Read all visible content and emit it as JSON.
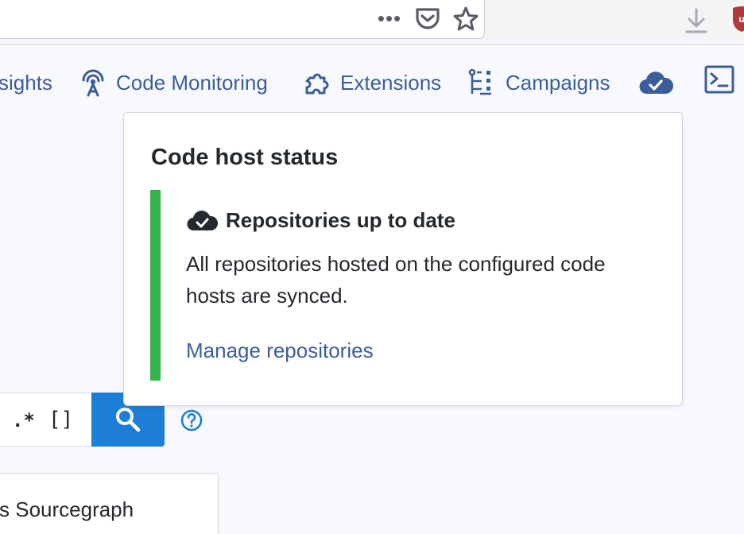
{
  "browser": {
    "more_glyph": "•••",
    "icons": [
      "more-icon",
      "pocket-icon",
      "bookmark-star-icon",
      "download-icon",
      "ublock-icon"
    ]
  },
  "nav": {
    "items": [
      {
        "label": "sights",
        "icon": "insights-icon"
      },
      {
        "label": "Code Monitoring",
        "icon": "antenna-icon"
      },
      {
        "label": "Extensions",
        "icon": "puzzle-icon"
      },
      {
        "label": "Campaigns",
        "icon": "campaigns-icon"
      }
    ],
    "status_icon": "cloud-check-icon",
    "terminal_icon": "terminal-icon"
  },
  "search": {
    "regex_toggle": ".*",
    "structural_toggle": "[]"
  },
  "card": {
    "text": "s Sourcegraph"
  },
  "popover": {
    "title": "Code host status",
    "status_heading": "Repositories up to date",
    "status_description": "All repositories hosted on the configured code hosts are synced.",
    "link": "Manage repositories"
  },
  "colors": {
    "link": "#3d5d99",
    "success": "#37b24d",
    "primary": "#1c7ed6",
    "text": "#24292e"
  }
}
